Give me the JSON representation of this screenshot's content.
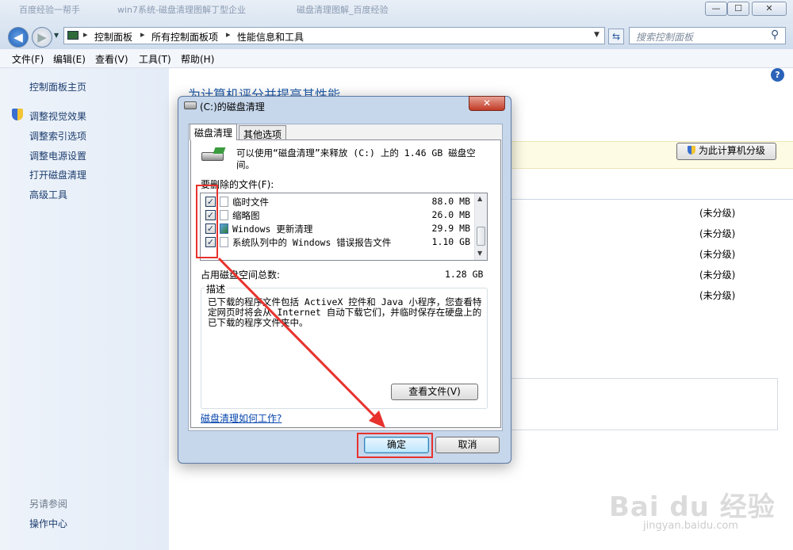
{
  "window": {
    "ghost_tabs": [
      "百度经验一帮手",
      "win7系统-磁盘清理图解丁型企业",
      "磁盘清理图解_百度经验"
    ],
    "minimize": "—",
    "maximize": "☐",
    "close": "✕"
  },
  "address": {
    "crumbs": [
      "控制面板",
      "所有控制面板项",
      "性能信息和工具"
    ],
    "search_placeholder": "搜索控制面板"
  },
  "menu": [
    "文件(F)",
    "编辑(E)",
    "查看(V)",
    "工具(T)",
    "帮助(H)"
  ],
  "sidebar": {
    "home": "控制面板主页",
    "links": [
      "调整视觉效果",
      "调整索引选项",
      "调整电源设置",
      "打开磁盘清理",
      "高级工具"
    ],
    "see_also_title": "另请参阅",
    "see_also": [
      "操作中心"
    ]
  },
  "main": {
    "heading": "为计算机评分并提高其性能",
    "rate_button": "为此计算机分级",
    "unrated": [
      "(未分级)",
      "(未分级)",
      "(未分级)",
      "(未分级)",
      "(未分级)"
    ]
  },
  "dialog": {
    "title": "(C:)的磁盘清理",
    "tabs": [
      "磁盘清理",
      "其他选项"
    ],
    "intro": "可以使用“磁盘清理”来释放 (C:) 上的 1.46 GB 磁盘空间。",
    "files_label": "要删除的文件(F):",
    "files": [
      {
        "name": "临时文件",
        "size": "88.0 MB",
        "checked": true
      },
      {
        "name": "缩略图",
        "size": "26.0 MB",
        "checked": true
      },
      {
        "name": "Windows 更新清理",
        "size": "29.9 MB",
        "checked": true
      },
      {
        "name": "系统队列中的 Windows 错误报告文件",
        "size": "1.10 GB",
        "checked": true
      }
    ],
    "total_label": "占用磁盘空间总数:",
    "total_value": "1.28 GB",
    "desc_title": "描述",
    "desc_text": "已下载的程序文件包括 ActiveX 控件和 Java 小程序，您查看特定网页时将会从 Internet 自动下载它们，并临时保存在硬盘上的已下载的程序文件夹中。",
    "view_files": "查看文件(V)",
    "howto_link": "磁盘清理如何工作?",
    "ok": "确定",
    "cancel": "取消"
  },
  "watermark": {
    "brand": "Bai du 经验",
    "url": "jingyan.baidu.com"
  },
  "colors": {
    "annotation_red": "#e8322d",
    "sidebar_link": "#1c3d6e",
    "heading_blue": "#1e5aa8"
  }
}
